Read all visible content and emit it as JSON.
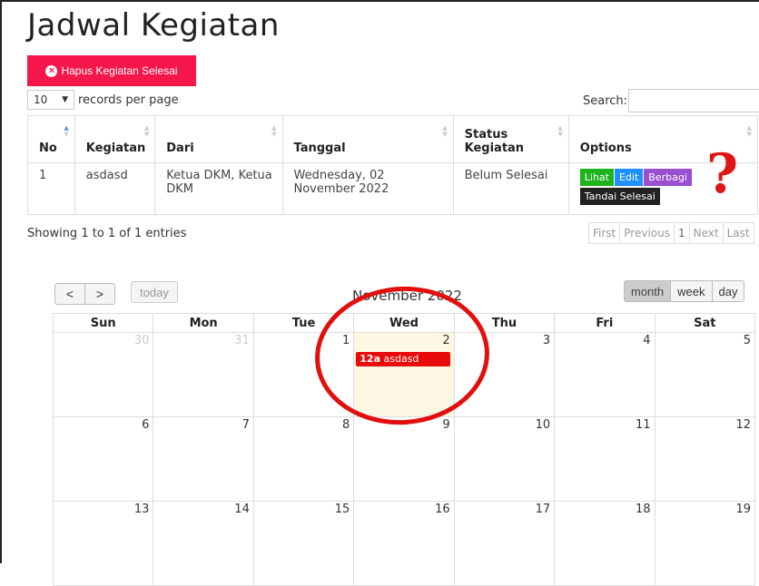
{
  "page": {
    "title": "Jadwal Kegiatan",
    "delete_done_label": "Hapus Kegiatan Selesai"
  },
  "table_controls": {
    "length_value": "10",
    "length_suffix": "records per page",
    "search_label": "Search:",
    "search_value": ""
  },
  "table": {
    "headers": [
      "No",
      "Kegiatan",
      "Dari",
      "Tanggal",
      "Status Kegiatan",
      "Options"
    ],
    "rows": [
      {
        "no": "1",
        "kegiatan": "asdasd",
        "dari": "Ketua DKM, Ketua DKM",
        "tanggal": "Wednesday, 02 November 2022",
        "status": "Belum Selesai"
      }
    ],
    "options": {
      "lihat": "Lihat",
      "edit": "Edit",
      "berbagi": "Berbagi",
      "tandai": "Tandai Selesai"
    }
  },
  "info": "Showing 1 to 1 of 1 entries",
  "pagination": {
    "first": "First",
    "previous": "Previous",
    "current": "1",
    "next": "Next",
    "last": "Last"
  },
  "annotation": {
    "mark": "?"
  },
  "calendar": {
    "prev": "<",
    "next": ">",
    "today": "today",
    "title": "November 2022",
    "views": [
      "month",
      "week",
      "day"
    ],
    "active_view": "month",
    "weekdays": [
      "Sun",
      "Mon",
      "Tue",
      "Wed",
      "Thu",
      "Fri",
      "Sat"
    ],
    "weeks": [
      [
        "30",
        "31",
        "1",
        "2",
        "3",
        "4",
        "5"
      ],
      [
        "6",
        "7",
        "8",
        "9",
        "10",
        "11",
        "12"
      ],
      [
        "13",
        "14",
        "15",
        "16",
        "17",
        "18",
        "19"
      ]
    ],
    "event": {
      "time": "12a",
      "title": "asdasd",
      "color": "#e80b0b"
    }
  },
  "colors": {
    "danger": "#f5174b",
    "success": "#1db31d",
    "primary": "#1e90ff",
    "purple": "#9a4fd0",
    "today_bg": "#fcf8e3",
    "annotation": "#e20f0f"
  }
}
